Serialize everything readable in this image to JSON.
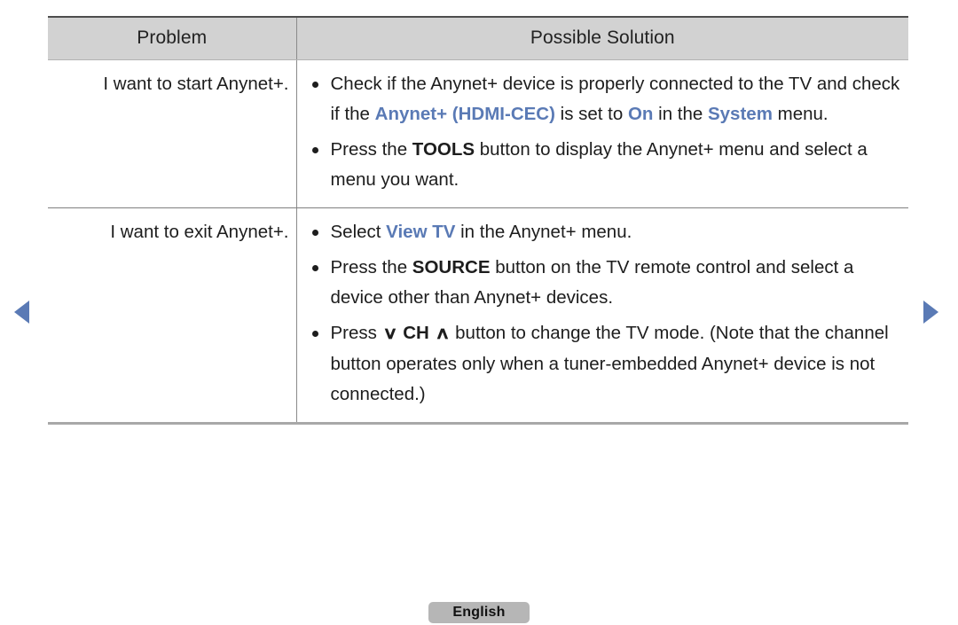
{
  "table": {
    "headers": {
      "problem": "Problem",
      "solution": "Possible Solution"
    },
    "rows": [
      {
        "problem": "I want to start Anynet+.",
        "bullets": [
          {
            "parts": [
              {
                "text": "Check if the Anynet+ device is properly connected to the TV and check if the ",
                "style": "plain"
              },
              {
                "text": "Anynet+ (HDMI-CEC)",
                "style": "accent"
              },
              {
                "text": " is set to ",
                "style": "plain"
              },
              {
                "text": "On",
                "style": "accent"
              },
              {
                "text": " in the ",
                "style": "plain"
              },
              {
                "text": "System",
                "style": "accent"
              },
              {
                "text": " menu.",
                "style": "plain"
              }
            ]
          },
          {
            "parts": [
              {
                "text": "Press the ",
                "style": "plain"
              },
              {
                "text": "TOOLS",
                "style": "bold"
              },
              {
                "text": " button to display the Anynet+ menu and select a menu you want.",
                "style": "plain"
              }
            ]
          }
        ]
      },
      {
        "problem": "I want to exit Anynet+.",
        "bullets": [
          {
            "parts": [
              {
                "text": "Select ",
                "style": "plain"
              },
              {
                "text": "View TV",
                "style": "accent"
              },
              {
                "text": " in the Anynet+ menu.",
                "style": "plain"
              }
            ]
          },
          {
            "parts": [
              {
                "text": "Press the ",
                "style": "plain"
              },
              {
                "text": "SOURCE",
                "style": "bold"
              },
              {
                "text": " button on the TV remote control and select a device other than Anynet+ devices.",
                "style": "plain"
              }
            ]
          },
          {
            "parts": [
              {
                "text": "Press ",
                "style": "plain"
              },
              {
                "text": "∨",
                "style": "chevron"
              },
              {
                "text": " CH ",
                "style": "bold"
              },
              {
                "text": "∧",
                "style": "chevron"
              },
              {
                "text": " button to change the TV mode. (Note that the channel button operates only when a tuner-embedded Anynet+ device is not connected.)",
                "style": "plain"
              }
            ]
          }
        ]
      }
    ]
  },
  "navigation": {
    "prev_icon": "triangle-left-icon",
    "next_icon": "triangle-right-icon"
  },
  "footer": {
    "language": "English"
  },
  "colors": {
    "accent_blue": "#5a7ab5",
    "header_gray": "#d2d2d2",
    "badge_gray": "#b6b6b6",
    "text_black": "#1d1d1d"
  }
}
